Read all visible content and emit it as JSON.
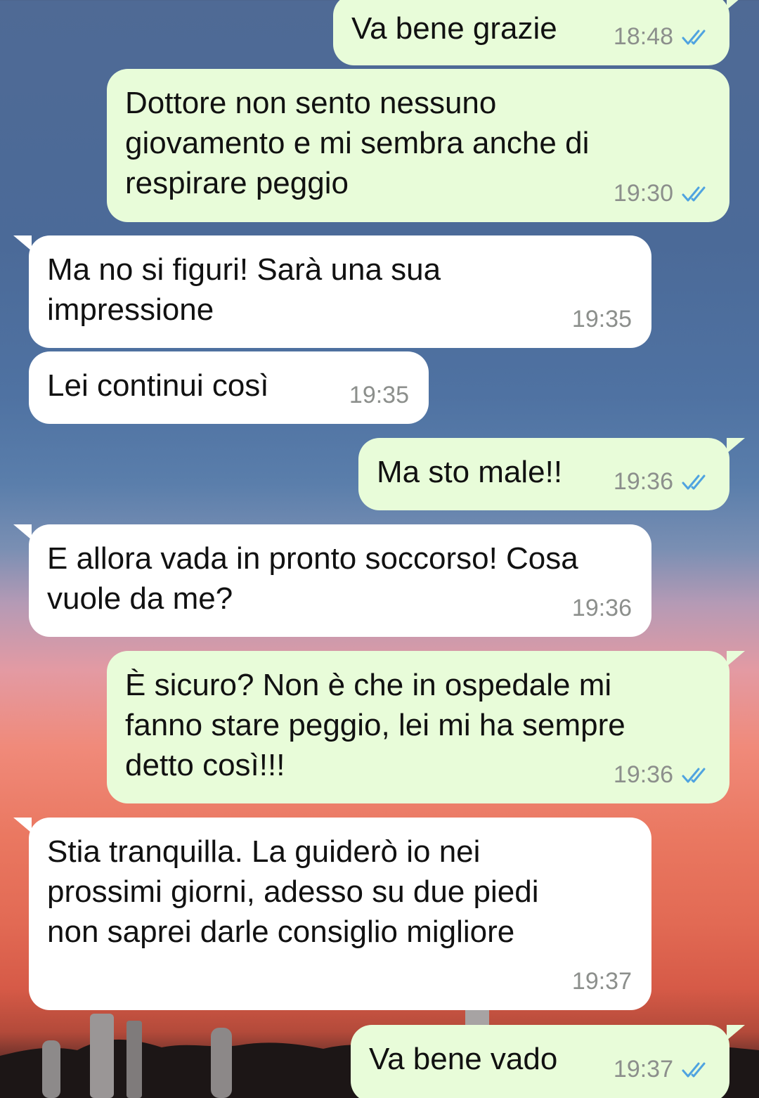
{
  "messages": [
    {
      "direction": "out",
      "text": "Va bene grazie",
      "time": "18:48",
      "status": "read"
    },
    {
      "direction": "out",
      "text": "Dottore non sento nessuno\ngiovamento e mi sembra anche di\nrespirare peggio",
      "time": "19:30",
      "status": "read"
    },
    {
      "direction": "in",
      "text": "Ma no si figuri! Sarà una sua\nimpressione",
      "time": "19:35"
    },
    {
      "direction": "in",
      "text": "Lei continui così",
      "time": "19:35"
    },
    {
      "direction": "out",
      "text": "Ma sto male!!",
      "time": "19:36",
      "status": "read"
    },
    {
      "direction": "in",
      "text": "E allora vada in pronto soccorso! Cosa\nvuole da me?",
      "time": "19:36"
    },
    {
      "direction": "out",
      "text": "È sicuro? Non è che in ospedale mi\nfanno stare peggio, lei mi ha sempre\ndetto così!!!",
      "time": "19:36",
      "status": "read"
    },
    {
      "direction": "in",
      "text": "Stia tranquilla. La guiderò io nei\nprossimi giorni, adesso su due piedi\nnon saprei darle consiglio migliore",
      "time": "19:37"
    },
    {
      "direction": "out",
      "text": "Va bene vado",
      "time": "19:37",
      "status": "read"
    }
  ],
  "colors": {
    "outgoing_bubble": "#e8fcd9",
    "incoming_bubble": "#ffffff",
    "read_ticks": "#4fa3e0",
    "timestamp": "#8c8f8c"
  },
  "icons": {
    "read_receipt": "double-check-icon"
  }
}
